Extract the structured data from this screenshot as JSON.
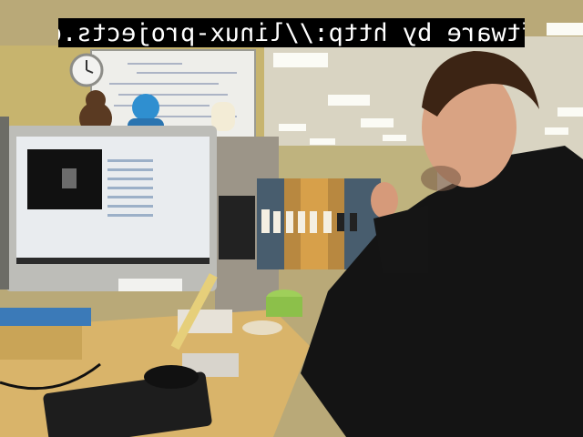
{
  "overlay": {
    "watermark_text": "software by http://linux-projects.org",
    "mirrored": true
  },
  "scene": {
    "monitor_screen_color": "#e9ecef",
    "wall_color": "#c9b98a",
    "person_jacket_color": "#141414",
    "desk_color": "#d9b46a"
  }
}
